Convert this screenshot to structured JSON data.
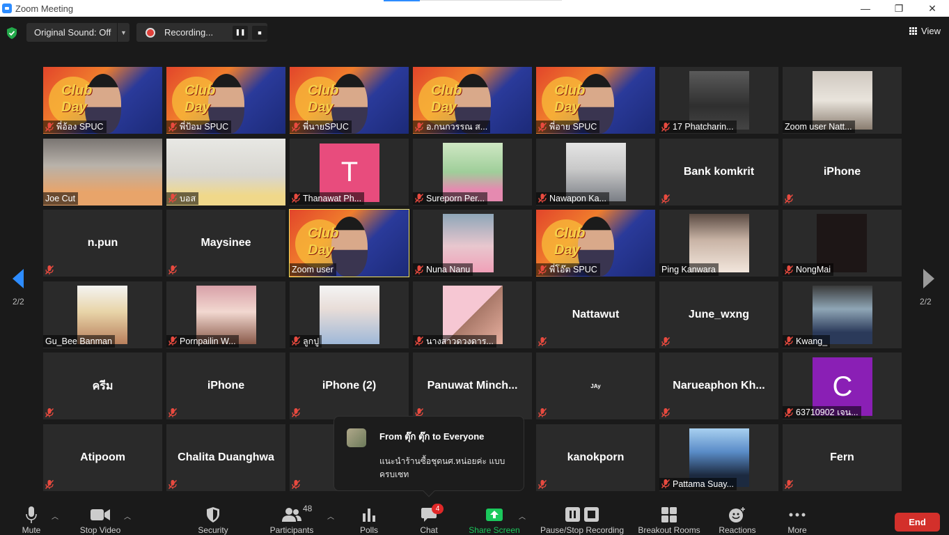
{
  "window": {
    "title": "Zoom Meeting",
    "minimize": "—",
    "maximize": "❐",
    "close": "✕"
  },
  "topbar": {
    "original_sound": "Original Sound: Off",
    "recording": "Recording...",
    "view": "View"
  },
  "pagination": {
    "left": "2/2",
    "right": "2/2"
  },
  "tiles": [
    {
      "name": "พี่อ้อง SPUC",
      "video": true,
      "bg": "club"
    },
    {
      "name": "พี่ป้อม SPUC",
      "video": true,
      "bg": "club"
    },
    {
      "name": "พี่นายSPUC",
      "video": true,
      "bg": "club"
    },
    {
      "name": "อ.กนกวรรณ ส...",
      "video": true,
      "bg": "club"
    },
    {
      "name": "พี่อาย SPUC",
      "video": true,
      "bg": "club"
    },
    {
      "name": "17 Phatcharin...",
      "video": true,
      "bg": "room"
    },
    {
      "name": "Zoom user Natt...",
      "video": true,
      "bg": "room2"
    },
    {
      "name": "Joe Cut",
      "video": true,
      "bg": "cam1"
    },
    {
      "name": "บอส",
      "video": true,
      "bg": "cam2"
    },
    {
      "name": "Thanawat Ph...",
      "video": false,
      "avatar": "T",
      "avatar_color": "#e84c7d"
    },
    {
      "name": "Sureporn Per...",
      "video": true,
      "bg": "photo1"
    },
    {
      "name": "Nawapon Ka...",
      "video": true,
      "bg": "photo2"
    },
    {
      "name": "Bank komkrit",
      "video": false
    },
    {
      "name": "iPhone",
      "video": false
    },
    {
      "name": "n.pun",
      "video": false
    },
    {
      "name": "Maysinee",
      "video": false
    },
    {
      "name": "Zoom user",
      "video": true,
      "bg": "club",
      "active": true
    },
    {
      "name": "Nuna Nanu",
      "video": true,
      "bg": "photo3"
    },
    {
      "name": "พี่โอ๊ต SPUC",
      "video": true,
      "bg": "club"
    },
    {
      "name": "Ping Kanwara",
      "video": true,
      "bg": "photo4"
    },
    {
      "name": "NongMai",
      "video": true,
      "bg": "dark"
    },
    {
      "name": "Gu_Bee Banman",
      "video": true,
      "bg": "photo5"
    },
    {
      "name": "Pornpailin W...",
      "video": true,
      "bg": "photo6"
    },
    {
      "name": "ลูกปู",
      "video": true,
      "bg": "photo7"
    },
    {
      "name": "นางสาวดวงดาร...",
      "video": true,
      "bg": "photo8"
    },
    {
      "name": "Nattawut",
      "video": false
    },
    {
      "name": "June_wxng",
      "video": false
    },
    {
      "name": "Kwang_",
      "video": true,
      "bg": "photo9"
    },
    {
      "name": "ครีม",
      "video": false
    },
    {
      "name": "iPhone",
      "video": false
    },
    {
      "name": "iPhone (2)",
      "video": false
    },
    {
      "name": "Panuwat  Minch...",
      "video": false
    },
    {
      "name": "JAy",
      "video": false,
      "small": true
    },
    {
      "name": "Narueaphon  Kh...",
      "video": false
    },
    {
      "name": "63710902 เจน...",
      "video": false,
      "avatar": "C",
      "avatar_color": "#8a1fb5"
    },
    {
      "name": "Atipoom",
      "video": false
    },
    {
      "name": "Chalita Duanghwa",
      "video": false
    },
    {
      "name": "P",
      "video": false
    },
    {
      "name": "",
      "video": false,
      "hidden": true
    },
    {
      "name": "kanokporn",
      "video": false
    },
    {
      "name": "Pattama Suay...",
      "video": true,
      "bg": "photo10"
    },
    {
      "name": "Fern",
      "video": false
    }
  ],
  "chat": {
    "from": "From ตุ๊ก ตุ๊ก to Everyone",
    "message": "แนะนำร้านซื้อชุดนศ.หน่อยค่ะ แบบครบเซท"
  },
  "toolbar": {
    "mute": "Mute",
    "stop_video": "Stop Video",
    "security": "Security",
    "participants": "Participants",
    "participants_count": "48",
    "polls": "Polls",
    "chat": "Chat",
    "chat_badge": "4",
    "share_screen": "Share Screen",
    "pause_stop_recording": "Pause/Stop Recording",
    "breakout_rooms": "Breakout Rooms",
    "reactions": "Reactions",
    "more": "More",
    "end": "End"
  },
  "colors": {
    "accent": "#2D8CFF",
    "share_green": "#1bc85c",
    "end_red": "#d3302b",
    "active_speaker": "#f2e35c",
    "mute_red": "#e0403a"
  }
}
